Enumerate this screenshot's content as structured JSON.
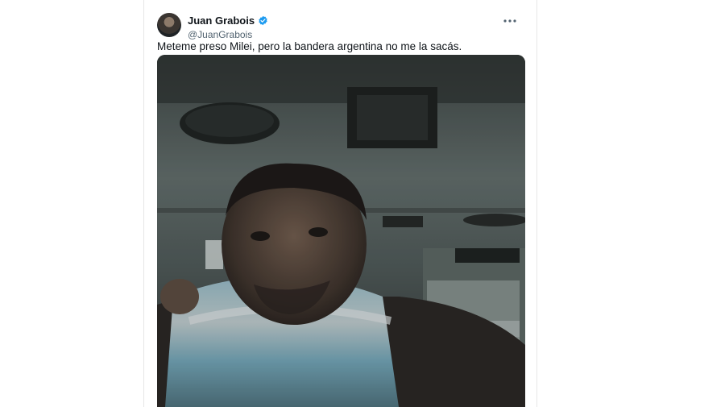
{
  "tweet": {
    "display_name": "Juan Grabois",
    "handle": "@JuanGrabois",
    "verified": true,
    "text": "Meteme preso Milei, pero la bandera argentina no me la sacás.",
    "media": {
      "type": "photo",
      "icon": "selfie-photo"
    }
  },
  "colors": {
    "verified_blue": "#1d9bf0",
    "text_primary": "#0f1419",
    "text_secondary": "#536471",
    "flag_blue": "#74acdf"
  }
}
